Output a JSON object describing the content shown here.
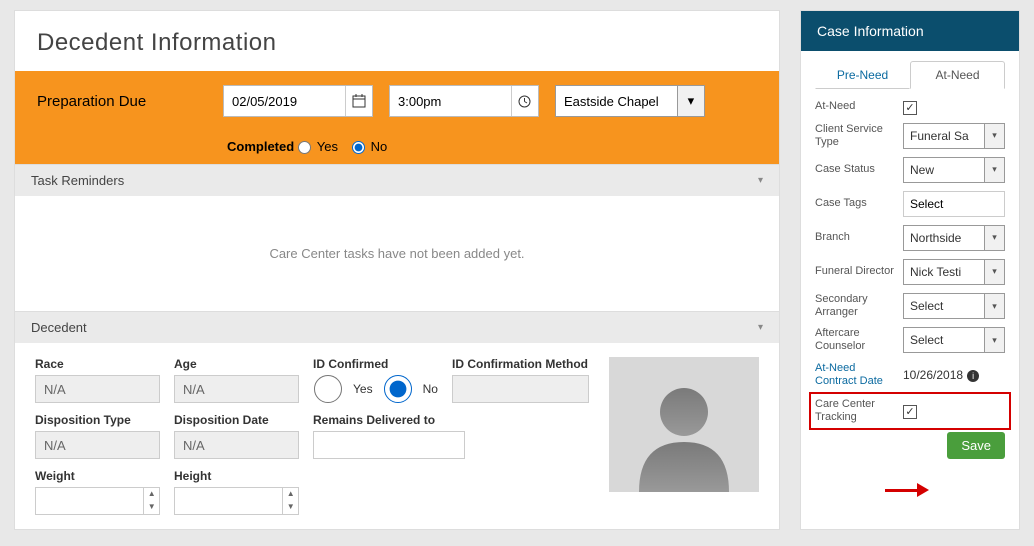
{
  "title": "Decedent Information",
  "prep": {
    "label": "Preparation Due",
    "date": "02/05/2019",
    "time": "3:00pm",
    "location": "Eastside Chapel",
    "completed_label": "Completed",
    "yes": "Yes",
    "no": "No"
  },
  "task_section": {
    "header": "Task Reminders",
    "empty": "Care Center tasks have not been added yet."
  },
  "decedent": {
    "header": "Decedent",
    "race_label": "Race",
    "race_value": "N/A",
    "age_label": "Age",
    "age_value": "N/A",
    "id_confirmed_label": "ID Confirmed",
    "yes": "Yes",
    "no": "No",
    "id_method_label": "ID Confirmation Method",
    "disposition_type_label": "Disposition Type",
    "disposition_type_value": "N/A",
    "disposition_date_label": "Disposition Date",
    "disposition_date_value": "N/A",
    "remains_label": "Remains Delivered to",
    "weight_label": "Weight",
    "height_label": "Height"
  },
  "case_info": {
    "header": "Case Information",
    "tab_preneed": "Pre-Need",
    "tab_atneed": "At-Need",
    "atneed_label": "At-Need",
    "client_service_type_label": "Client Service Type",
    "client_service_type_value": "Funeral Sa",
    "case_status_label": "Case Status",
    "case_status_value": "New",
    "case_tags_label": "Case Tags",
    "case_tags_value": "Select",
    "branch_label": "Branch",
    "branch_value": "Northside",
    "funeral_director_label": "Funeral Director",
    "funeral_director_value": "Nick Testi",
    "secondary_arranger_label": "Secondary Arranger",
    "secondary_arranger_value": "Select",
    "aftercare_label": "Aftercare Counselor",
    "aftercare_value": "Select",
    "contract_date_label": "At-Need Contract Date",
    "contract_date_value": "10/26/2018",
    "care_center_label": "Care Center Tracking",
    "save": "Save"
  }
}
